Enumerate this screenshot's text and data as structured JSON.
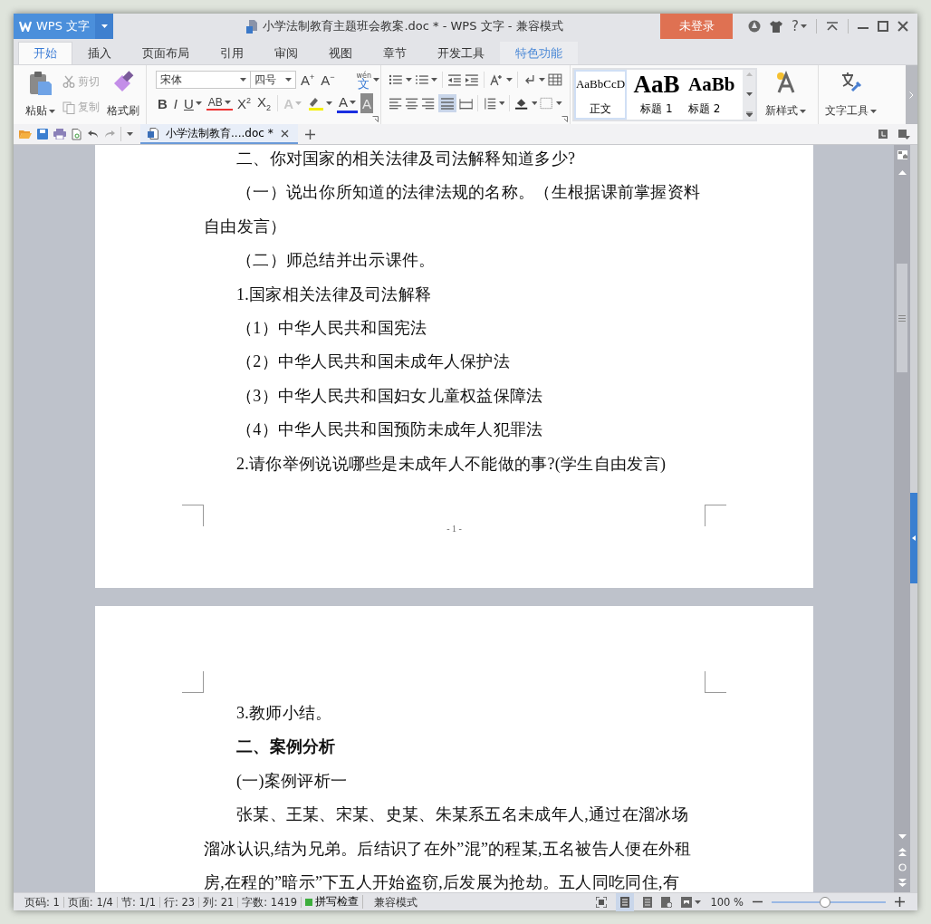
{
  "app_button": {
    "label": "WPS 文字"
  },
  "title": "小学法制教育主题班会教案.doc * - WPS 文字 - 兼容模式",
  "login_button": "未登录",
  "help_label": "?",
  "tabs": [
    {
      "label": "开始",
      "selected": true,
      "hovered": false
    },
    {
      "label": "插入",
      "selected": false,
      "hovered": false
    },
    {
      "label": "页面布局",
      "selected": false,
      "hovered": false
    },
    {
      "label": "引用",
      "selected": false,
      "hovered": false
    },
    {
      "label": "审阅",
      "selected": false,
      "hovered": false
    },
    {
      "label": "视图",
      "selected": false,
      "hovered": false
    },
    {
      "label": "章节",
      "selected": false,
      "hovered": false
    },
    {
      "label": "开发工具",
      "selected": false,
      "hovered": false
    },
    {
      "label": "特色功能",
      "selected": false,
      "hovered": true
    }
  ],
  "clipboard": {
    "paste": "粘贴",
    "cut": {
      "label": "剪切",
      "disabled": true
    },
    "copy": {
      "label": "复制",
      "disabled": true
    },
    "format_painter": "格式刷"
  },
  "font": {
    "name": "宋体",
    "size": "四号",
    "row1_tools": [
      {
        "glyph": "A$^{+}$",
        "kind": "plain"
      },
      {
        "glyph": "A$^{−}$",
        "kind": "plain"
      },
      {
        "glyph": "文",
        "ruby": "wén",
        "kind": "phonetic"
      }
    ],
    "row2_tools": [
      {
        "glyph": "B",
        "kind": "bold"
      },
      {
        "glyph": "I",
        "kind": "italic"
      },
      {
        "glyph": "U",
        "kind": "underline"
      },
      {
        "glyph": "AB",
        "kind": "strike"
      },
      {
        "glyph": "X$^{2}$",
        "kind": "plain"
      },
      {
        "glyph": "X$_{2}$",
        "kind": "plain"
      },
      {
        "glyph": "A",
        "kind": "faded"
      },
      {
        "glyph": "A",
        "kind": "color"
      },
      {
        "glyph": "A",
        "kind": "shaded"
      }
    ]
  },
  "styles": [
    {
      "preview": "AaBbCcD",
      "label": "正文",
      "selected": true,
      "kind": "normal"
    },
    {
      "preview": "AaB",
      "label": "标题 1",
      "selected": false,
      "kind": "h1"
    },
    {
      "preview": "AaBb",
      "label": "标题 2",
      "selected": false,
      "kind": "h2"
    }
  ],
  "new_style": "新样式",
  "text_tools": "文字工具",
  "doc_tab": {
    "label": "小学法制教育....doc *",
    "selected": true
  },
  "pages": [
    {
      "number": "- 1 -",
      "paragraphs": [
        {
          "text": "二、你对国家的相关法律及司法解释知道多少?",
          "bold": false
        },
        {
          "text": "（一）说出你所知道的法律法规的名称。（生根据课前掌握资料自由发言）",
          "bold": false
        },
        {
          "text": "（二）师总结并出示课件。",
          "bold": false
        },
        {
          "text": "1.国家相关法律及司法解释",
          "bold": false
        },
        {
          "text": "（1）中华人民共和国宪法",
          "bold": false
        },
        {
          "text": "（2）中华人民共和国未成年人保护法",
          "bold": false
        },
        {
          "text": "（3）中华人民共和国妇女儿童权益保障法",
          "bold": false
        },
        {
          "text": "（4）中华人民共和国预防未成年人犯罪法",
          "bold": false
        },
        {
          "text": "2.请你举例说说哪些是未成年人不能做的事?(学生自由发言)",
          "bold": false
        }
      ]
    },
    {
      "paragraphs": [
        {
          "text": "3.教师小结。",
          "bold": false
        },
        {
          "text": "二、案例分析",
          "bold": true
        },
        {
          "text": "(一)案例评析一",
          "bold": false
        },
        {
          "text": "张某、王某、宋某、史某、朱某系五名未成年人,通过在溜冰场溜冰认识,结为兄弟。后结识了在外”混”的程某,五名被告人便在外租房,在程的”暗示”下五人开始盗窃,后发展为抢劫。五人同吃同住,有",
          "bold": false
        }
      ]
    }
  ],
  "status": {
    "items": [
      "页码: 1",
      "页面: 1/4",
      "节: 1/1",
      "行: 23",
      "列: 21",
      "字数: 1419"
    ],
    "spell_check": "拼写检查",
    "mode": "兼容模式",
    "zoom": "100 %",
    "zoom_slider": {
      "level": 0.47
    }
  }
}
